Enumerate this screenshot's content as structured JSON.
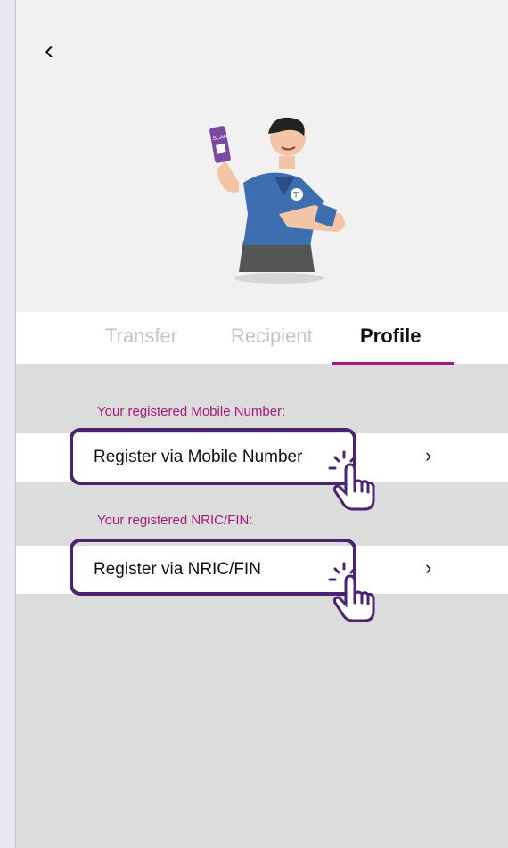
{
  "tabs": [
    {
      "label": "Transfer"
    },
    {
      "label": "Recipient"
    },
    {
      "label": "Profile"
    }
  ],
  "sections": {
    "mobile": {
      "caption": "Your registered Mobile Number:",
      "row_label": "Register via Mobile Number",
      "chevron": "›"
    },
    "nric": {
      "caption": "Your registered NRIC/FIN:",
      "row_label": "Register via NRIC/FIN",
      "chevron": "›"
    }
  },
  "nav": {
    "back_glyph": "‹"
  },
  "colors": {
    "accent": "#a3197b",
    "highlight": "#4a2470",
    "background": "#dcdcdc"
  },
  "icons": [
    "back-arrow-icon",
    "chevron-right-icon",
    "pointing-hand-icon"
  ]
}
